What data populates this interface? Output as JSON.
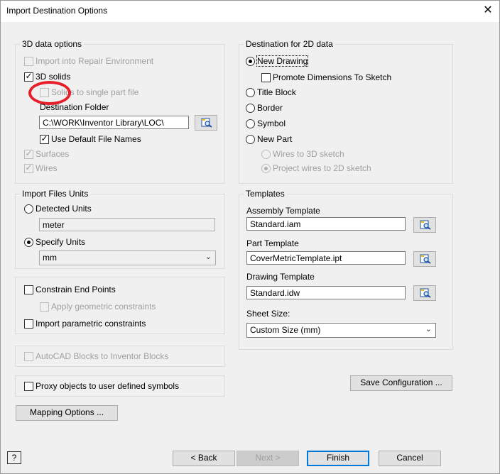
{
  "window": {
    "title": "Import Destination Options",
    "close_glyph": "✕"
  },
  "options3d": {
    "legend": "3D data options",
    "repair_env": {
      "label": "Import into Repair Environment",
      "checked": false
    },
    "solids": {
      "label": "3D solids",
      "checked": true
    },
    "single_part": {
      "label": "Solids to single part file",
      "checked": false
    },
    "dest_folder_label": "Destination Folder",
    "dest_folder_value": "C:\\WORK\\Inventor Library\\LOC\\",
    "default_names": {
      "label": "Use Default File Names",
      "checked": true
    },
    "surfaces": {
      "label": "Surfaces",
      "checked": true
    },
    "wires": {
      "label": "Wires",
      "checked": true
    }
  },
  "units": {
    "legend": "Import Files Units",
    "detected": {
      "label": "Detected Units",
      "selected": false
    },
    "detected_value": "meter",
    "specify": {
      "label": "Specify Units",
      "selected": true
    },
    "specify_value": "mm"
  },
  "constraints": {
    "end_points": {
      "label": "Constrain End Points",
      "checked": false
    },
    "geometric": {
      "label": "Apply geometric constraints",
      "checked": false
    },
    "parametric": {
      "label": "Import parametric constraints",
      "checked": false
    }
  },
  "autocad_blocks": {
    "label": "AutoCAD Blocks to Inventor Blocks",
    "checked": false
  },
  "proxy": {
    "label": "Proxy objects to user defined symbols",
    "checked": false
  },
  "mapping_button": "Mapping Options ...",
  "dest2d": {
    "legend": "Destination for 2D data",
    "new_drawing": {
      "label": "New Drawing",
      "selected": true
    },
    "promote_dims": {
      "label": "Promote Dimensions To Sketch",
      "checked": false
    },
    "title_block": {
      "label": "Title Block",
      "selected": false
    },
    "border": {
      "label": "Border",
      "selected": false
    },
    "symbol": {
      "label": "Symbol",
      "selected": false
    },
    "new_part": {
      "label": "New Part",
      "selected": false
    },
    "wires_3d": {
      "label": "Wires to 3D sketch",
      "selected": false
    },
    "project_2d": {
      "label": "Project wires to 2D sketch",
      "selected": true
    }
  },
  "templates": {
    "legend": "Templates",
    "assembly_label": "Assembly Template",
    "assembly_value": "Standard.iam",
    "part_label": "Part Template",
    "part_value": "CoverMetricTemplate.ipt",
    "drawing_label": "Drawing Template",
    "drawing_value": "Standard.idw",
    "sheet_label": "Sheet Size:",
    "sheet_value": "Custom Size (mm)"
  },
  "save_config_button": "Save Configuration ...",
  "footer": {
    "help": "?",
    "back": "< Back",
    "next": "Next >",
    "finish": "Finish",
    "cancel": "Cancel"
  },
  "icons": {
    "browse": "folder-browse-icon",
    "dropdown": "chevron-down-icon",
    "close": "close-icon"
  },
  "colors": {
    "highlight_circle": "#e5202a",
    "accent": "#0078d7"
  }
}
